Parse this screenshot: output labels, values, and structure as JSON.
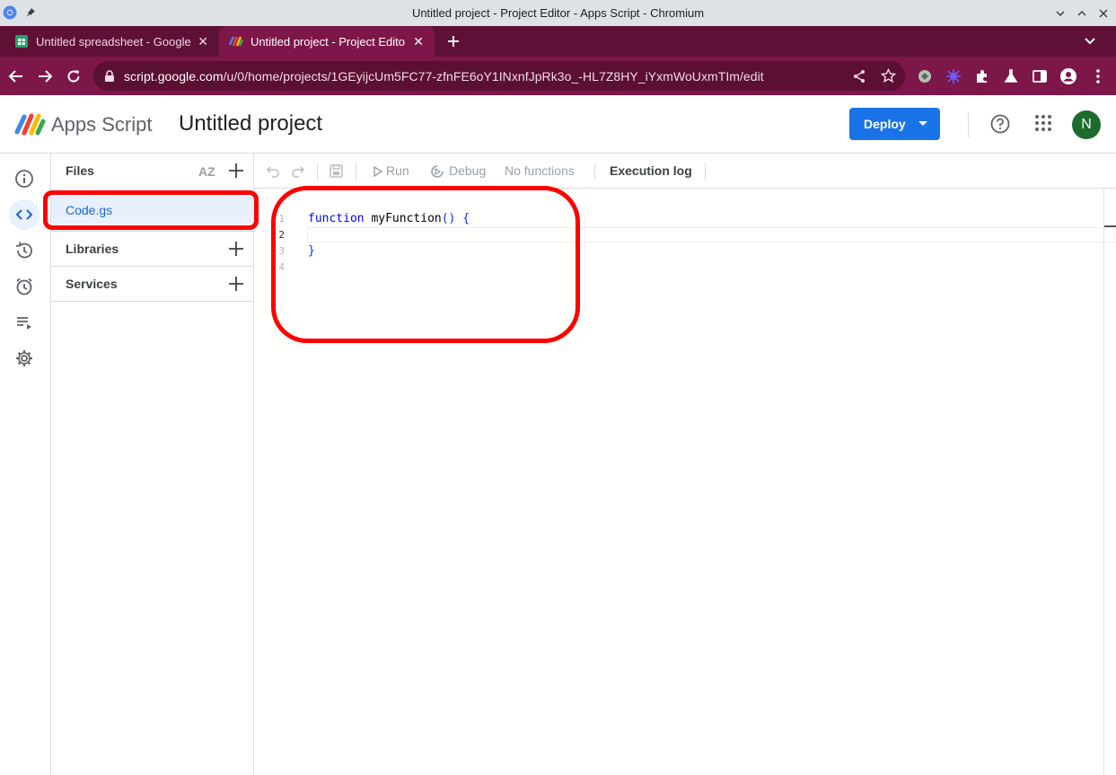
{
  "window": {
    "title": "Untitled project - Project Editor - Apps Script - Chromium"
  },
  "tabs": [
    {
      "label": "Untitled spreadsheet - Google Sheets",
      "active": false
    },
    {
      "label": "Untitled project - Project Editor - Apps Script",
      "active": true
    }
  ],
  "address_bar": {
    "url_host": "script.google.com",
    "url_path": "/u/0/home/projects/1GEyijcUm5FC77-zfnFE6oY1INxnfJpRk3o_-HL7Z8HY_iYxmWoUxmTIm/edit"
  },
  "header": {
    "brand": "Apps Script",
    "project_title": "Untitled project",
    "deploy_label": "Deploy",
    "avatar_initial": "N"
  },
  "files_panel": {
    "files_heading": "Files",
    "sort_label": "AZ",
    "file_name": "Code.gs",
    "libraries_label": "Libraries",
    "services_label": "Services"
  },
  "toolbar": {
    "run_label": "Run",
    "debug_label": "Debug",
    "function_select": "No functions",
    "execution_log_label": "Execution log"
  },
  "editor": {
    "line_numbers": [
      "1",
      "2",
      "3",
      "4"
    ],
    "code": {
      "kw_function": "function",
      "fn_name": "myFunction",
      "fn_sig_rest": "() {",
      "closing": "}"
    }
  },
  "colors": {
    "accent_blue": "#1a73e8",
    "tab_strip": "#5f1037",
    "toolbar_frame": "#7d1649",
    "highlight": "#ff0000",
    "avatar": "#1e6b2e"
  }
}
